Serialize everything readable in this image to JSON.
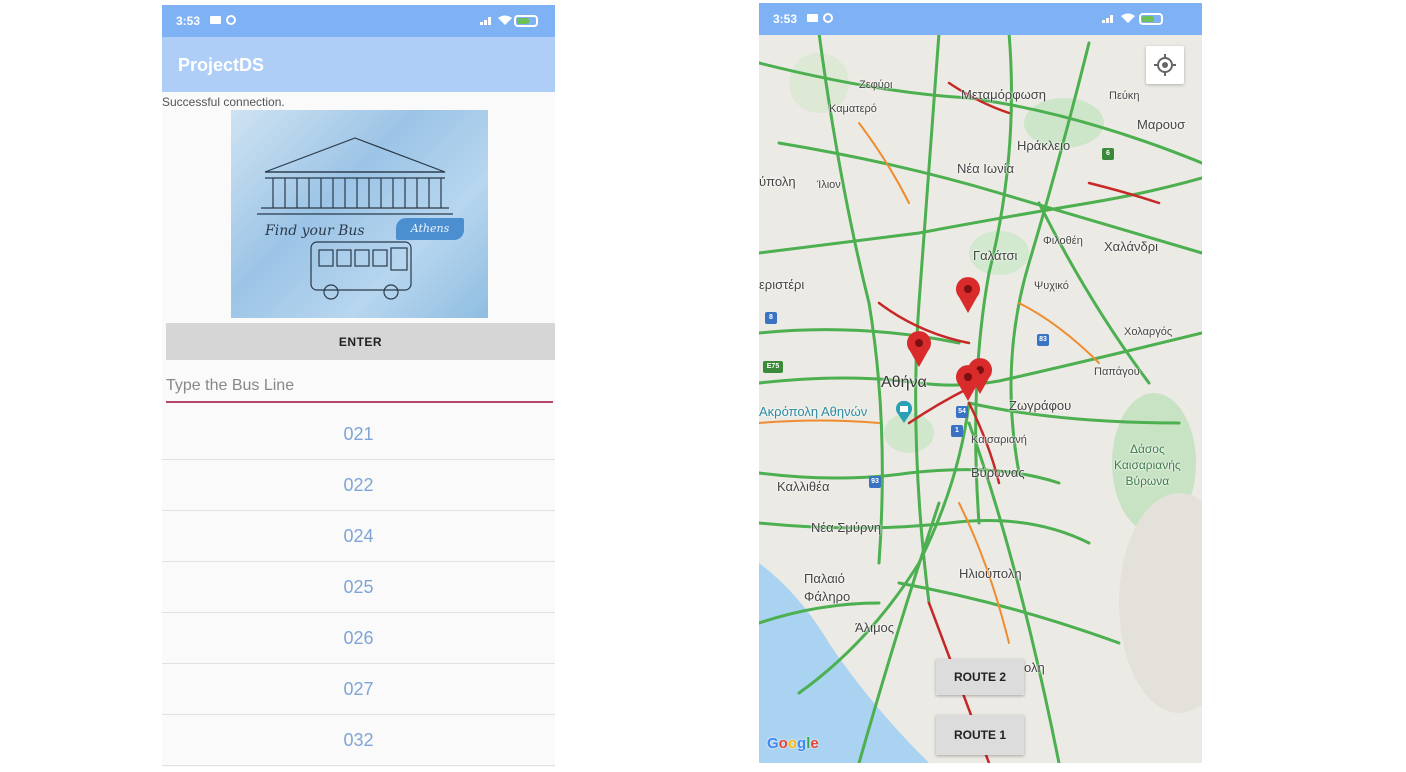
{
  "left_phone": {
    "status": {
      "time": "3:53"
    },
    "app_title": "ProjectDS",
    "connection_status": "Successful connection.",
    "hero": {
      "caption": "Find your Bus",
      "tag": "Athens"
    },
    "enter_label": "ENTER",
    "search": {
      "placeholder": "Type the Bus Line",
      "value": ""
    },
    "bus_lines": [
      "021",
      "022",
      "024",
      "025",
      "026",
      "027",
      "032"
    ]
  },
  "right_phone": {
    "status": {
      "time": "3:53"
    },
    "map_labels": {
      "zefyri": "Ζεφύρι",
      "kamatero": "Καματερό",
      "metamorfosi": "Μεταμόρφωση",
      "pefki": "Πεύκη",
      "marousi": "Μαρουσ",
      "irakleio": "Ηράκλειο",
      "nea_ionia": "Νέα Ιωνία",
      "polis_partial": "ύπολη",
      "ilion": "Ίλιον",
      "filothei": "Φιλοθέη",
      "chalandri": "Χαλάνδρι",
      "galatsi": "Γαλάτσι",
      "psychiko": "Ψυχικό",
      "peristeri_partial": "εριστέρι",
      "cholargos": "Χολαργός",
      "papagou": "Παπάγου",
      "athina": "Αθήνα",
      "akropoli": "Ακρόπολη Αθηνών",
      "zografou": "Ζωγράφου",
      "kaisariani": "Καισαριανή",
      "dasos": "Δάσος\nΚαισαριανής\nΒύρωνα",
      "vyronas": "Βύρωνας",
      "kallithea": "Καλλιθέα",
      "nea_smyrni": "Νέα Σμύρνη",
      "palaio_faliro": "Παλαιό\nΦάληρο",
      "ilioupoli": "Ηλιούπολη",
      "alimos": "Άλιμος",
      "argyroupoli_partial": "ολη"
    },
    "shields": {
      "s8": "8",
      "s75": "E75",
      "s83": "83",
      "s54": "54",
      "s1": "1",
      "s93": "93",
      "s6": "6"
    },
    "route2_label": "ROUTE 2",
    "route1_label": "ROUTE 1",
    "google": "Google"
  },
  "colors": {
    "status_bar": "#7fb2f4",
    "app_bar": "#aecdf7",
    "list_text": "#7fa5d6",
    "underline": "#b5456a",
    "pin": "#d92b2b",
    "traffic_green": "#4caf50",
    "traffic_red": "#c62828"
  },
  "icons": [
    "camera-icon",
    "sync-icon",
    "signal-icon",
    "wifi-icon",
    "battery-icon",
    "my-location-icon",
    "map-pin-icon"
  ]
}
